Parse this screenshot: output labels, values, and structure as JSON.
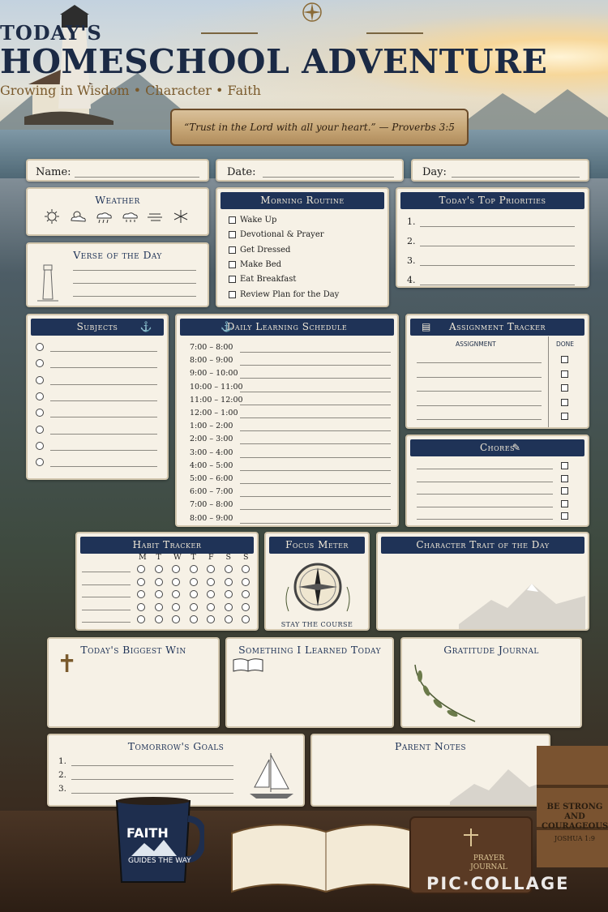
{
  "header": {
    "title_small": "TODAY'S",
    "title_big": "HOMESCHOOL ADVENTURE",
    "subtitle": "Growing in Wisdom • Character • Faith",
    "verse_banner": "“Trust in the Lord with all your heart.” — Proverbs 3:5"
  },
  "info": {
    "name_label": "Name:",
    "date_label": "Date:",
    "day_label": "Day:"
  },
  "weather": {
    "title": "Weather",
    "icons": [
      "sun-icon",
      "partly-cloudy-icon",
      "rain-icon",
      "showers-icon",
      "wind-icon",
      "snow-icon"
    ]
  },
  "verse": {
    "title": "Verse of the Day"
  },
  "morning": {
    "title": "Morning Routine",
    "items": [
      "Wake Up",
      "Devotional & Prayer",
      "Get Dressed",
      "Make Bed",
      "Eat Breakfast",
      "Review Plan for the Day"
    ]
  },
  "priorities": {
    "title": "Today's Top Priorities",
    "items": [
      "1.",
      "2.",
      "3.",
      "4."
    ]
  },
  "subjects": {
    "title": "Subjects"
  },
  "schedule": {
    "title": "Daily Learning Schedule",
    "times": [
      "7:00 – 8:00",
      "8:00 – 9:00",
      "9:00 – 10:00",
      "10:00 – 11:00",
      "11:00 – 12:00",
      "12:00 – 1:00",
      "1:00 – 2:00",
      "2:00 – 3:00",
      "3:00 – 4:00",
      "4:00 – 5:00",
      "5:00 – 6:00",
      "6:00 – 7:00",
      "7:00 – 8:00",
      "8:00 – 9:00"
    ]
  },
  "assignments": {
    "title": "Assignment Tracker",
    "col_assignment": "ASSIGNMENT",
    "col_done": "DONE"
  },
  "chores": {
    "title": "Chores"
  },
  "habits": {
    "title": "Habit Tracker",
    "days": [
      "M",
      "T",
      "W",
      "T",
      "F",
      "S",
      "S"
    ]
  },
  "focus": {
    "title": "Focus Meter",
    "caption": "STAY THE COURSE"
  },
  "trait": {
    "title": "Character Trait of the Day"
  },
  "win": {
    "title": "Today's Biggest Win"
  },
  "learned": {
    "title": "Something I Learned Today"
  },
  "gratitude": {
    "title": "Gratitude Journal"
  },
  "tomorrow": {
    "title": "Tomorrow's Goals",
    "items": [
      "1.",
      "2.",
      "3."
    ]
  },
  "parent": {
    "title": "Parent Notes"
  },
  "props": {
    "mug_line1": "FAITH",
    "mug_line2": "GUIDES THE WAY",
    "journal_label": "PRAYER JOURNAL",
    "crate_line1": "BE STRONG AND COURAGEOUS",
    "crate_line2": "JOSHUA 1:9"
  },
  "watermark": "PIC·COLLAGE",
  "colors": {
    "navy": "#1f3357",
    "paper": "#f6f1e6",
    "wood": "#6b4c2a"
  }
}
